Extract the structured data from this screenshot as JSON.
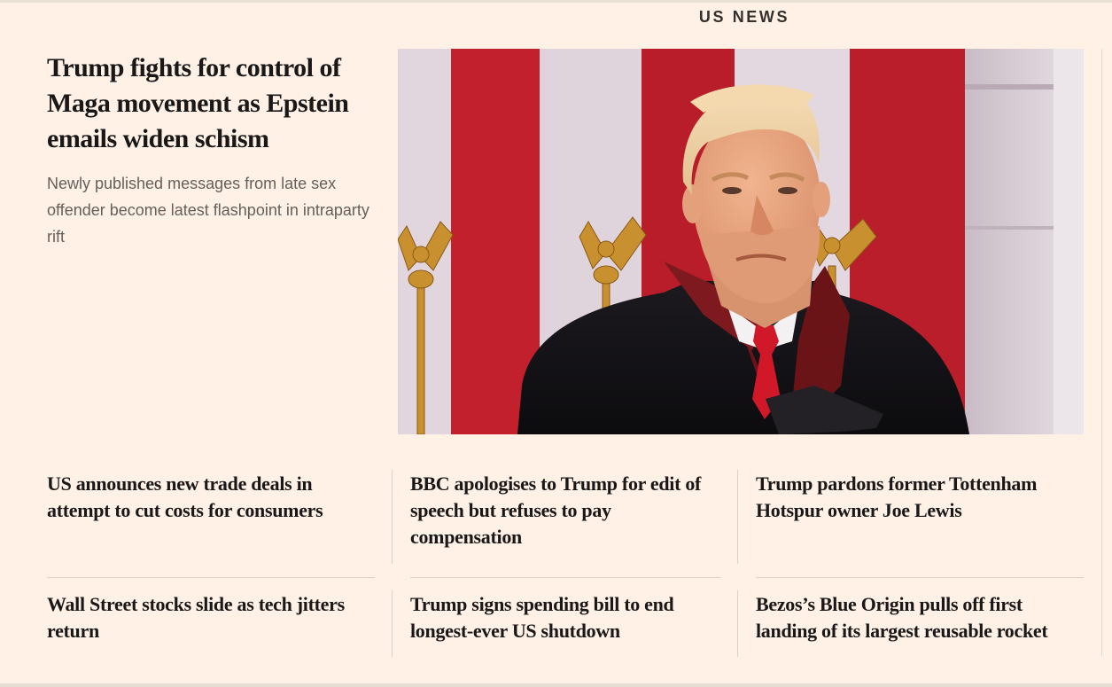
{
  "section": {
    "title": "US NEWS"
  },
  "lead": {
    "headline": "Trump fights for control of Maga movement as Epstein emails widen schism",
    "standfirst": "Newly published messages from late sex offender become latest flashpoint in intraparty rift",
    "image": "photo-of-donald-trump"
  },
  "stories": [
    {
      "headline": "US announces new trade deals in attempt to cut costs for consumers"
    },
    {
      "headline": "BBC apologises to Trump for edit of speech but refuses to pay compensation"
    },
    {
      "headline": "Trump pardons former Tottenham Hotspur owner Joe Lewis"
    },
    {
      "headline": "Wall Street stocks slide as tech jitters return"
    },
    {
      "headline": "Trump signs spending bill to end longest-ever US shutdown"
    },
    {
      "headline": "Bezos’s Blue Origin pulls off first landing of its largest reusable rocket"
    }
  ],
  "colors": {
    "page_background": "#fff1e5",
    "headline_text": "#1a1718",
    "standfirst_text": "#66605c",
    "rule": "#dcd1c6"
  }
}
